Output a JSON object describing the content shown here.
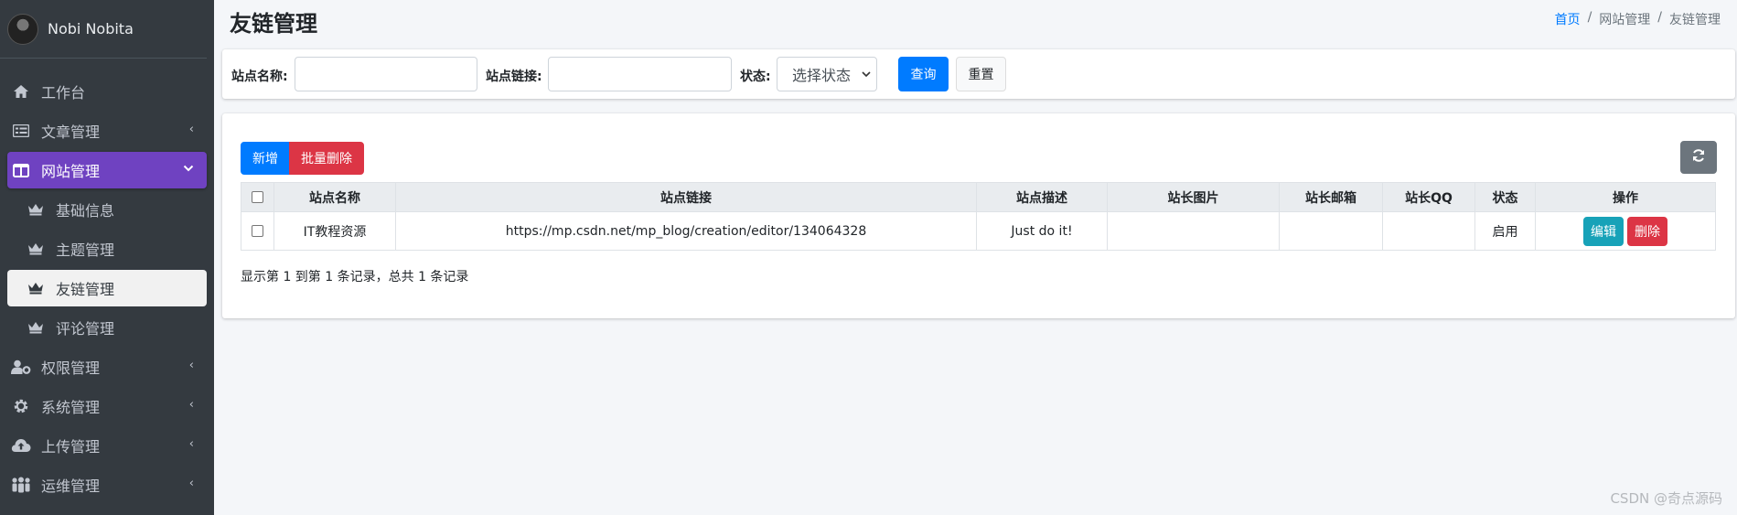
{
  "user": {
    "name": "Nobi Nobita"
  },
  "menu": [
    {
      "label": "工作台",
      "icon": "home-icon",
      "chevron": ""
    },
    {
      "label": "文章管理",
      "icon": "list-icon",
      "chevron": "‹"
    },
    {
      "label": "网站管理",
      "icon": "columns-icon",
      "chevron": "⌄"
    }
  ],
  "submenu": [
    {
      "label": "基础信息",
      "icon": "crown-icon"
    },
    {
      "label": "主题管理",
      "icon": "crown-icon"
    },
    {
      "label": "友链管理",
      "icon": "crown-icon"
    },
    {
      "label": "评论管理",
      "icon": "crown-icon"
    }
  ],
  "menu_bottom": [
    {
      "label": "权限管理",
      "icon": "user-cog-icon",
      "chevron": "‹"
    },
    {
      "label": "系统管理",
      "icon": "gear-icon",
      "chevron": "‹"
    },
    {
      "label": "上传管理",
      "icon": "cloud-upload-icon",
      "chevron": "‹"
    },
    {
      "label": "运维管理",
      "icon": "users-icon",
      "chevron": "‹"
    }
  ],
  "page": {
    "title": "友链管理"
  },
  "breadcrumb": {
    "home": "首页",
    "sep1": "/",
    "parent": "网站管理",
    "sep2": "/",
    "current": "友链管理"
  },
  "filter": {
    "name_label": "站点名称:",
    "name_value": "",
    "url_label": "站点链接:",
    "url_value": "",
    "status_label": "状态:",
    "status_selected": "选择状态",
    "query_button": "查询",
    "reset_button": "重置"
  },
  "toolbar": {
    "add_button": "新增",
    "batch_delete_button": "批量删除",
    "refresh_icon": "refresh-icon"
  },
  "table": {
    "headers": [
      "站点名称",
      "站点链接",
      "站点描述",
      "站长图片",
      "站长邮箱",
      "站长QQ",
      "状态",
      "操作"
    ],
    "rows": [
      {
        "name": "IT教程资源",
        "url": "https://mp.csdn.net/mp_blog/creation/editor/134064328",
        "desc": "Just do it!",
        "image": "",
        "email": "",
        "qq": "",
        "status": "启用",
        "edit_button": "编辑",
        "delete_button": "删除"
      }
    ],
    "summary": "显示第 1 到第 1 条记录，总共 1 条记录"
  },
  "watermark": "CSDN @奇点源码",
  "colors": {
    "sidebar": "#343a40",
    "active": "#6f42c1",
    "primary": "#007bff",
    "danger": "#dc3545",
    "info": "#17a2b8"
  }
}
